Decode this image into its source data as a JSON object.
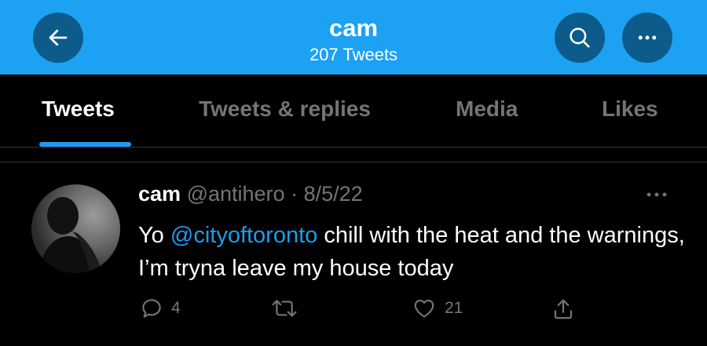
{
  "header": {
    "name": "cam",
    "tweet_count": "207 Tweets"
  },
  "tabs": [
    {
      "label": "Tweets",
      "active": true
    },
    {
      "label": "Tweets & replies",
      "active": false
    },
    {
      "label": "Media",
      "active": false
    },
    {
      "label": "Likes",
      "active": false
    }
  ],
  "tweet": {
    "author_name": "cam",
    "author_handle": "@antihero",
    "separator": "·",
    "date": "8/5/22",
    "text_before": "Yo ",
    "mention": "@cityoftoronto",
    "text_after": " chill with the heat and the warnings, I’m tryna leave my house today",
    "replies": "4",
    "retweets": "",
    "likes": "21"
  },
  "icons": {
    "back": "arrow-left-icon",
    "search": "search-icon",
    "more": "more-horizontal-icon",
    "reply": "reply-icon",
    "retweet": "retweet-icon",
    "like": "heart-icon",
    "share": "share-icon"
  },
  "colors": {
    "header": "#1da1f2",
    "accent": "#1d9bf0",
    "background": "#000000",
    "muted": "#71767b"
  }
}
